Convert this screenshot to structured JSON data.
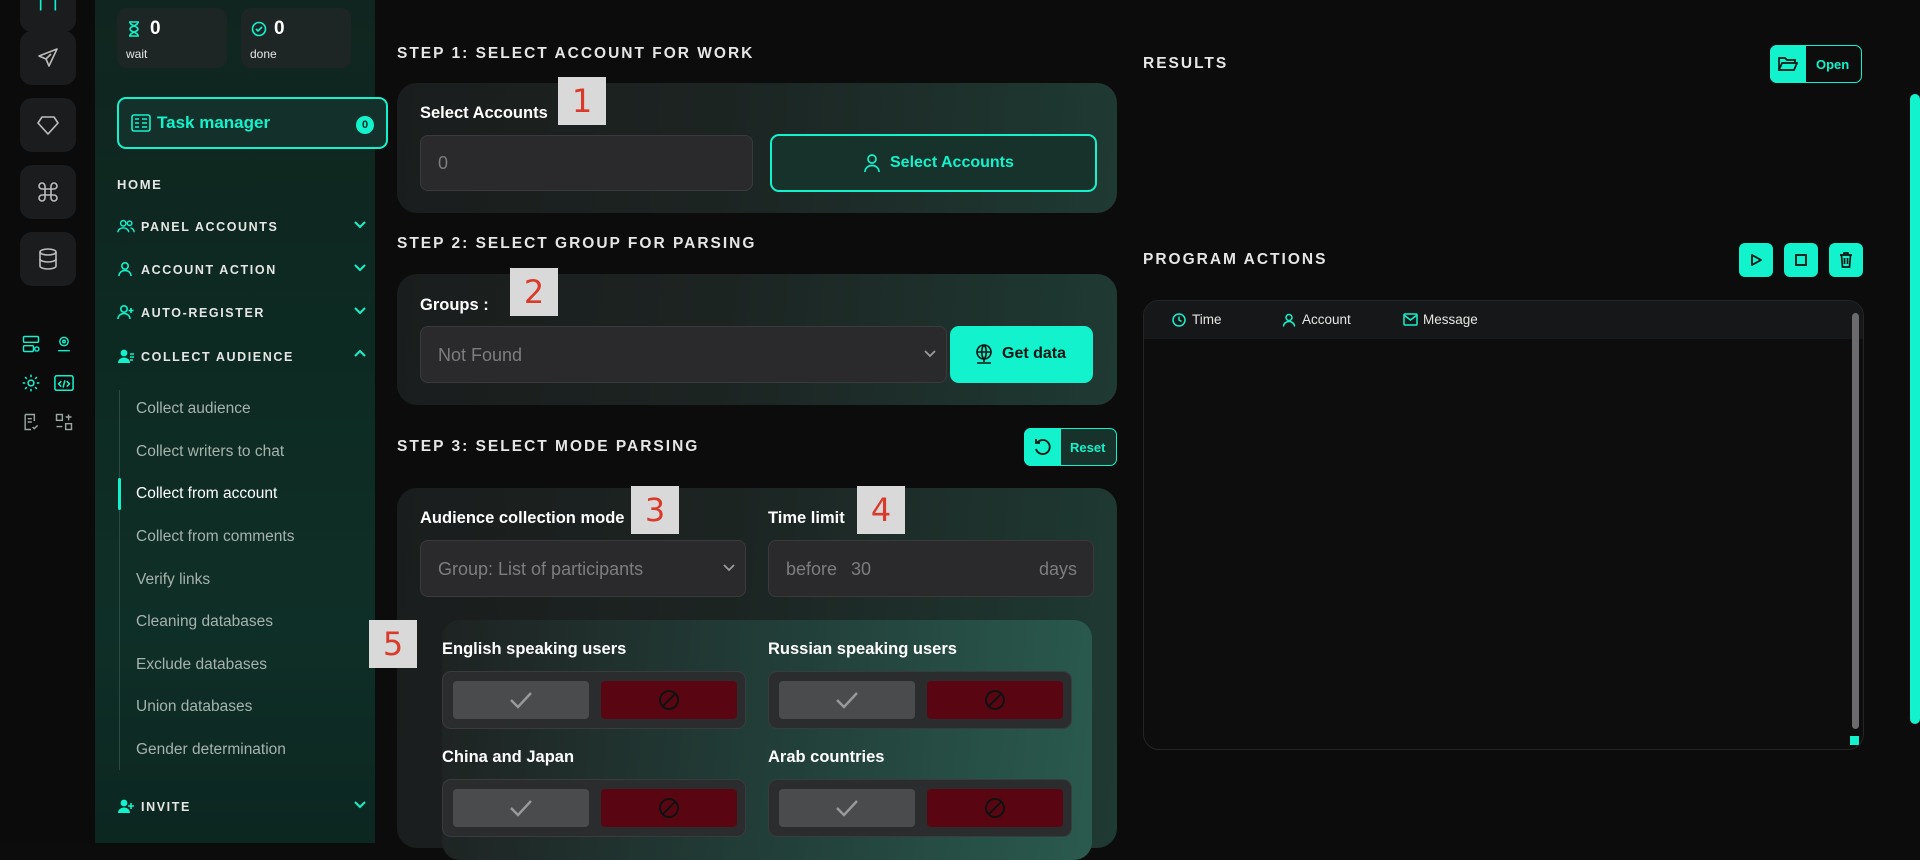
{
  "stats": {
    "wait_count": "0",
    "wait_label": "wait",
    "done_count": "0",
    "done_label": "done"
  },
  "task_manager": {
    "label": "Task manager",
    "badge": "0"
  },
  "nav": {
    "home": "HOME",
    "sections": [
      {
        "label": "PANEL ACCOUNTS",
        "icon": "users-icon"
      },
      {
        "label": "ACCOUNT ACTION",
        "icon": "user-icon"
      },
      {
        "label": "AUTO-REGISTER",
        "icon": "user-plus-icon"
      },
      {
        "label": "COLLECT AUDIENCE",
        "icon": "user-group-icon"
      },
      {
        "label": "INVITE",
        "icon": "user-invite-icon"
      }
    ],
    "collect_items": [
      "Collect audience",
      "Collect writers to chat",
      "Collect from account",
      "Collect from comments",
      "Verify links",
      "Cleaning databases",
      "Exclude databases",
      "Union databases",
      "Gender determination"
    ],
    "active_item": "Collect from account"
  },
  "step1": {
    "title": "STEP 1: SELECT ACCOUNT FOR WORK",
    "label": "Select Accounts",
    "value": "0",
    "button": "Select Accounts",
    "marker": "1"
  },
  "step2": {
    "title": "STEP 2: SELECT GROUP FOR PARSING",
    "label": "Groups :",
    "selected": "Not Found",
    "button": "Get data",
    "marker": "2"
  },
  "step3": {
    "title": "STEP 3: SELECT MODE PARSING",
    "reset_button": "Reset",
    "mode_label": "Audience collection mode",
    "mode_selected": "Group: List of participants",
    "mode_marker": "3",
    "time_label": "Time limit",
    "time_prefix": "before",
    "time_value": "30",
    "time_suffix": "days",
    "time_marker": "4",
    "lang_marker": "5",
    "languages": [
      "English speaking users",
      "Russian speaking users",
      "China and Japan",
      "Arab countries"
    ]
  },
  "results": {
    "title": "RESULTS",
    "open_button": "Open"
  },
  "actions": {
    "title": "PROGRAM ACTIONS",
    "columns": [
      "Time",
      "Account",
      "Message"
    ]
  },
  "colors": {
    "accent": "#12f2cc",
    "danger": "#5a0612",
    "background": "#0c0c0d"
  }
}
